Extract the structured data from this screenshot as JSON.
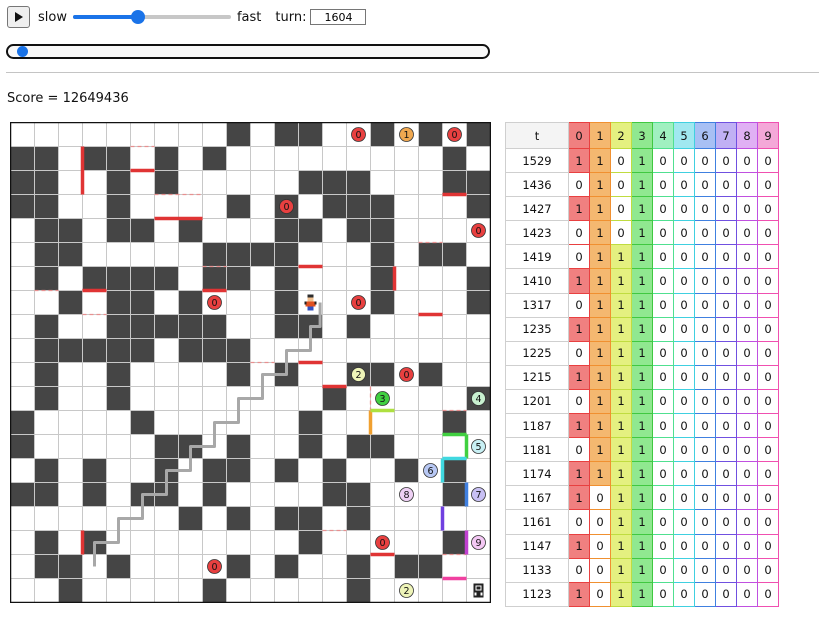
{
  "controls": {
    "slow_label": "slow",
    "fast_label": "fast",
    "turn_label": "turn:",
    "turn_value": "1604",
    "speed_level": 0.4,
    "turn_progress": 0.02
  },
  "score_text": "Score = 12649436",
  "grid": {
    "rows": 20,
    "cols": 20,
    "cells": [
      "000000000#0##00#0#0#",
      "##0##0#0#000000000#0",
      "##00#0#00000###000##",
      "##00#0000#0#0###000#",
      "0##0##0#000##0##0000",
      "0##00000####000#0##0",
      "0#0####0##0#000#000#",
      "00#0##0#000#000#000#",
      "0#00#####00##0#00000",
      "0#####0###0000000000",
      "0#00#0000#0#00##0#00",
      "0#00#00000000#00000#",
      "#0000#000000#00000#0",
      "#00000##0#00#0##0000",
      "0#0#00#0##0#0#00#0#0",
      "##0#0##0#0000##000#0",
      "0000000#0#0##0#00000",
      "0#0#00000000#00000#0",
      "0##0#0000#0#00#0##00",
      "00#00000#00000#00000"
    ]
  },
  "walls": [
    {
      "r1": 1,
      "c1": 3,
      "r2": 3,
      "c2": 3,
      "color": "#e03434"
    },
    {
      "r1": 2,
      "c1": 5,
      "r2": 2,
      "c2": 6,
      "color": "#e03434"
    },
    {
      "r1": 4,
      "c1": 6,
      "r2": 4,
      "c2": 8,
      "color": "#e03434"
    },
    {
      "r1": 7,
      "c1": 3,
      "r2": 7,
      "c2": 4,
      "color": "#e03434"
    },
    {
      "r1": 7,
      "c1": 8,
      "r2": 7,
      "c2": 9,
      "color": "#e03434"
    },
    {
      "r1": 6,
      "c1": 12,
      "r2": 6,
      "c2": 13,
      "color": "#e03434"
    },
    {
      "r1": 6,
      "c1": 16,
      "r2": 7,
      "c2": 16,
      "color": "#e03434"
    },
    {
      "r1": 3,
      "c1": 18,
      "r2": 3,
      "c2": 19,
      "color": "#e03434"
    },
    {
      "r1": 8,
      "c1": 17,
      "r2": 8,
      "c2": 18,
      "color": "#e03434"
    },
    {
      "r1": 10,
      "c1": 12,
      "r2": 10,
      "c2": 13,
      "color": "#e03434"
    },
    {
      "r1": 11,
      "c1": 13,
      "r2": 11,
      "c2": 14,
      "color": "#e03434"
    },
    {
      "r1": 17,
      "c1": 3,
      "r2": 18,
      "c2": 3,
      "color": "#e03434"
    },
    {
      "r1": 18,
      "c1": 15,
      "r2": 18,
      "c2": 16,
      "color": "#e03434"
    },
    {
      "r1": 12,
      "c1": 15,
      "r2": 13,
      "c2": 15,
      "color": "#f0a030"
    },
    {
      "r1": 12,
      "c1": 15,
      "r2": 12,
      "c2": 16,
      "color": "#aee040"
    },
    {
      "r1": 13,
      "c1": 18,
      "r2": 13,
      "c2": 19,
      "color": "#40d040"
    },
    {
      "r1": 13,
      "c1": 19,
      "r2": 14,
      "c2": 19,
      "color": "#40d040"
    },
    {
      "r1": 14,
      "c1": 18,
      "r2": 14,
      "c2": 19,
      "color": "#40d8e0"
    },
    {
      "r1": 14,
      "c1": 18,
      "r2": 15,
      "c2": 18,
      "color": "#40d8e0"
    },
    {
      "r1": 15,
      "c1": 19,
      "r2": 16,
      "c2": 19,
      "color": "#4080e0"
    },
    {
      "r1": 16,
      "c1": 18,
      "r2": 17,
      "c2": 18,
      "color": "#7040e0"
    },
    {
      "r1": 17,
      "c1": 19,
      "r2": 18,
      "c2": 19,
      "color": "#c040d0"
    },
    {
      "r1": 19,
      "c1": 18,
      "r2": 19,
      "c2": 19,
      "color": "#f040a0"
    }
  ],
  "dashed_walls": [
    {
      "r1": 1,
      "c1": 5,
      "r2": 1,
      "c2": 6
    },
    {
      "r1": 3,
      "c1": 6,
      "r2": 3,
      "c2": 8
    },
    {
      "r1": 5,
      "c1": 17,
      "r2": 5,
      "c2": 18
    },
    {
      "r1": 7,
      "c1": 1,
      "r2": 7,
      "c2": 2
    },
    {
      "r1": 6,
      "c1": 8,
      "r2": 6,
      "c2": 9
    },
    {
      "r1": 8,
      "c1": 3,
      "r2": 8,
      "c2": 4
    },
    {
      "r1": 10,
      "c1": 10,
      "r2": 10,
      "c2": 11
    },
    {
      "r1": 11,
      "c1": 15,
      "r2": 12,
      "c2": 15
    },
    {
      "r1": 12,
      "c1": 18,
      "r2": 12,
      "c2": 19
    },
    {
      "r1": 17,
      "c1": 13,
      "r2": 17,
      "c2": 14
    },
    {
      "r1": 18,
      "c1": 18,
      "r2": 18,
      "c2": 19
    }
  ],
  "markers": [
    {
      "r": 0,
      "c": 14,
      "label": "0",
      "color": "#e84040"
    },
    {
      "r": 0,
      "c": 16,
      "label": "1",
      "color": "#f0a850"
    },
    {
      "r": 0,
      "c": 18,
      "label": "0",
      "color": "#e84040"
    },
    {
      "r": 3,
      "c": 11,
      "label": "0",
      "color": "#e84040"
    },
    {
      "r": 4,
      "c": 19,
      "label": "0",
      "color": "#e84040"
    },
    {
      "r": 7,
      "c": 8,
      "label": "0",
      "color": "#e84040"
    },
    {
      "r": 7,
      "c": 14,
      "label": "0",
      "color": "#e84040"
    },
    {
      "r": 10,
      "c": 14,
      "label": "2",
      "color": "#eef4b8"
    },
    {
      "r": 10,
      "c": 16,
      "label": "0",
      "color": "#e84040"
    },
    {
      "r": 11,
      "c": 15,
      "label": "3",
      "color": "#40d040"
    },
    {
      "r": 11,
      "c": 19,
      "label": "4",
      "color": "#c8f0d0"
    },
    {
      "r": 13,
      "c": 19,
      "label": "5",
      "color": "#c8f0f4"
    },
    {
      "r": 14,
      "c": 17,
      "label": "6",
      "color": "#b8c8f4"
    },
    {
      "r": 15,
      "c": 16,
      "label": "8",
      "color": "#eed0f4"
    },
    {
      "r": 15,
      "c": 19,
      "label": "7",
      "color": "#c8c0f4"
    },
    {
      "r": 17,
      "c": 15,
      "label": "0",
      "color": "#e84040"
    },
    {
      "r": 17,
      "c": 19,
      "label": "9",
      "color": "#f4c8f4"
    },
    {
      "r": 18,
      "c": 8,
      "label": "0",
      "color": "#e84040"
    },
    {
      "r": 19,
      "c": 16,
      "label": "2",
      "color": "#eef4b8"
    }
  ],
  "path": [
    [
      18,
      3
    ],
    [
      17,
      3
    ],
    [
      17,
      4
    ],
    [
      16,
      4
    ],
    [
      16,
      5
    ],
    [
      15,
      5
    ],
    [
      15,
      6
    ],
    [
      14,
      6
    ],
    [
      14,
      7
    ],
    [
      13,
      7
    ],
    [
      13,
      8
    ],
    [
      12,
      8
    ],
    [
      12,
      9
    ],
    [
      11,
      9
    ],
    [
      11,
      10
    ],
    [
      10,
      10
    ],
    [
      10,
      11
    ],
    [
      9,
      11
    ],
    [
      9,
      12
    ],
    [
      8,
      12
    ],
    [
      8,
      12.4
    ],
    [
      7,
      12.4
    ]
  ],
  "player": {
    "r": 7,
    "c": 12,
    "icon": "player-icon"
  },
  "goal": {
    "r": 19,
    "c": 19,
    "icon": "goal-icon"
  },
  "table": {
    "header_t": "t",
    "column_labels": [
      "0",
      "1",
      "2",
      "3",
      "4",
      "5",
      "6",
      "7",
      "8",
      "9"
    ],
    "column_bg": [
      "#f08080",
      "#f4b870",
      "#e4f080",
      "#90e890",
      "#a0f0c0",
      "#a0e8f0",
      "#a8c0f4",
      "#c0b0f4",
      "#e0b0f4",
      "#f4a8d8"
    ],
    "column_border": [
      "#e84040",
      "#f09030",
      "#c0dc40",
      "#40c840",
      "#50e090",
      "#40d0e0",
      "#4080e0",
      "#7050e0",
      "#c050e0",
      "#f050b0"
    ],
    "rows": [
      {
        "t": "1529",
        "v": [
          1,
          1,
          0,
          1,
          0,
          0,
          0,
          0,
          0,
          0
        ]
      },
      {
        "t": "1436",
        "v": [
          0,
          1,
          0,
          1,
          0,
          0,
          0,
          0,
          0,
          0
        ]
      },
      {
        "t": "1427",
        "v": [
          1,
          1,
          0,
          1,
          0,
          0,
          0,
          0,
          0,
          0
        ]
      },
      {
        "t": "1423",
        "v": [
          0,
          1,
          0,
          1,
          0,
          0,
          0,
          0,
          0,
          0
        ]
      },
      {
        "t": "1419",
        "v": [
          0,
          1,
          1,
          1,
          0,
          0,
          0,
          0,
          0,
          0
        ]
      },
      {
        "t": "1410",
        "v": [
          1,
          1,
          1,
          1,
          0,
          0,
          0,
          0,
          0,
          0
        ]
      },
      {
        "t": "1317",
        "v": [
          0,
          1,
          1,
          1,
          0,
          0,
          0,
          0,
          0,
          0
        ]
      },
      {
        "t": "1235",
        "v": [
          1,
          1,
          1,
          1,
          0,
          0,
          0,
          0,
          0,
          0
        ]
      },
      {
        "t": "1225",
        "v": [
          0,
          1,
          1,
          1,
          0,
          0,
          0,
          0,
          0,
          0
        ]
      },
      {
        "t": "1215",
        "v": [
          1,
          1,
          1,
          1,
          0,
          0,
          0,
          0,
          0,
          0
        ]
      },
      {
        "t": "1201",
        "v": [
          0,
          1,
          1,
          1,
          0,
          0,
          0,
          0,
          0,
          0
        ]
      },
      {
        "t": "1187",
        "v": [
          1,
          1,
          1,
          1,
          0,
          0,
          0,
          0,
          0,
          0
        ]
      },
      {
        "t": "1181",
        "v": [
          0,
          1,
          1,
          1,
          0,
          0,
          0,
          0,
          0,
          0
        ]
      },
      {
        "t": "1174",
        "v": [
          1,
          1,
          1,
          1,
          0,
          0,
          0,
          0,
          0,
          0
        ]
      },
      {
        "t": "1167",
        "v": [
          1,
          0,
          1,
          1,
          0,
          0,
          0,
          0,
          0,
          0
        ]
      },
      {
        "t": "1161",
        "v": [
          0,
          0,
          1,
          1,
          0,
          0,
          0,
          0,
          0,
          0
        ]
      },
      {
        "t": "1147",
        "v": [
          1,
          0,
          1,
          1,
          0,
          0,
          0,
          0,
          0,
          0
        ]
      },
      {
        "t": "1133",
        "v": [
          0,
          0,
          1,
          1,
          0,
          0,
          0,
          0,
          0,
          0
        ]
      },
      {
        "t": "1123",
        "v": [
          1,
          0,
          1,
          1,
          0,
          0,
          0,
          0,
          0,
          0
        ]
      }
    ]
  }
}
